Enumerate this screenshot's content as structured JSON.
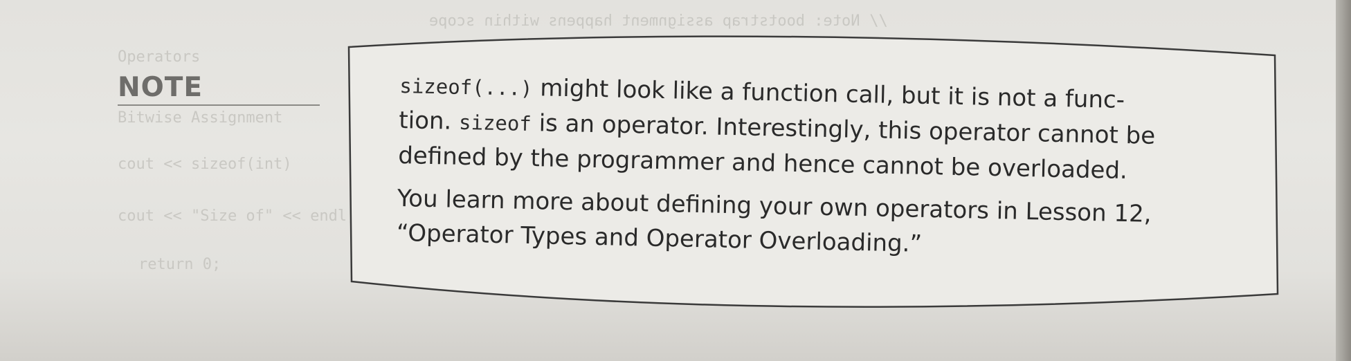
{
  "note": {
    "label": "NOTE"
  },
  "callout": {
    "para1": {
      "line1_code": "sizeof(...)",
      "line1_text": " might look like a function call, but it is not a func-",
      "line2_prefix": "tion. ",
      "line2_code": "sizeof",
      "line2_text": " is an operator. Interestingly, this operator cannot be",
      "line3_text": "defined by the programmer and hence cannot be overloaded."
    },
    "para2": {
      "line1_text": "You learn more about defining your own operators in Lesson 12,",
      "line2_text": "“Operator Types and Operator Overloading.”"
    }
  },
  "colors": {
    "paper": "#e5e4e0",
    "text": "#2a2a2a",
    "label": "#6e6d6a",
    "border": "#3a3a3a"
  }
}
